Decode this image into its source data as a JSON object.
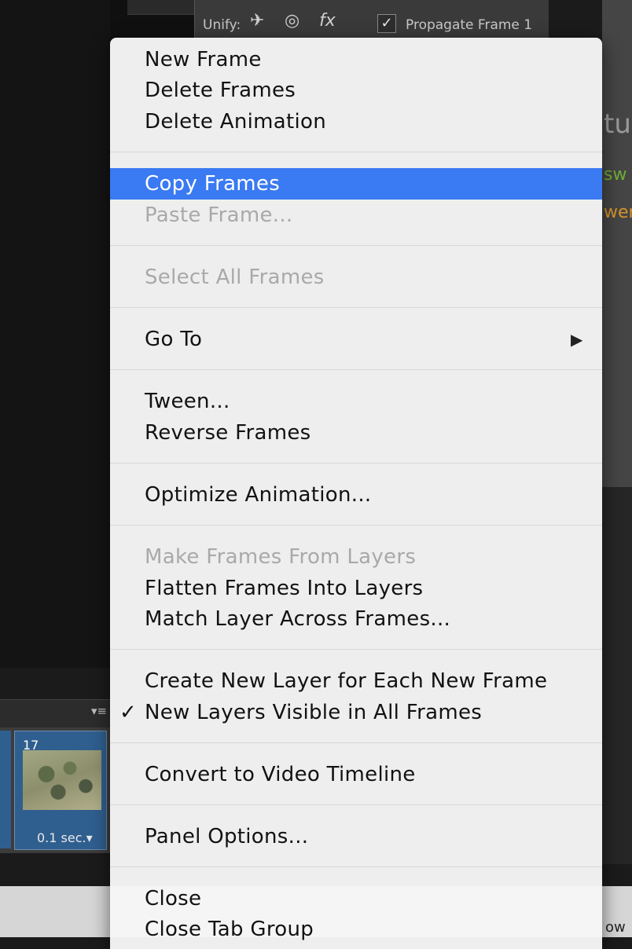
{
  "toolbar": {
    "unify_label": "Unify:",
    "icons": [
      "position-link-icon",
      "visibility-link-icon",
      "style-link-icon"
    ],
    "propagate_label": "Propagate Frame 1",
    "propagate_checked": true
  },
  "background": {
    "right_text_1": "tus",
    "right_text_2": "sw",
    "right_text_3": "wer",
    "bottom_right_text": "ow"
  },
  "frames": {
    "frame_number": "17",
    "frame_delay": "0.1 sec."
  },
  "menu": {
    "items": [
      {
        "label": "New Frame",
        "enabled": true
      },
      {
        "label": "Delete Frames",
        "enabled": true
      },
      {
        "label": "Delete Animation",
        "enabled": true
      },
      {
        "label": "Copy Frames",
        "enabled": true,
        "highlighted": true
      },
      {
        "label": "Paste Frame...",
        "enabled": false
      },
      {
        "label": "Select All Frames",
        "enabled": false
      },
      {
        "label": "Go To",
        "enabled": true,
        "submenu": true
      },
      {
        "label": "Tween...",
        "enabled": true
      },
      {
        "label": "Reverse Frames",
        "enabled": true
      },
      {
        "label": "Optimize Animation...",
        "enabled": true
      },
      {
        "label": "Make Frames From Layers",
        "enabled": false
      },
      {
        "label": "Flatten Frames Into Layers",
        "enabled": true
      },
      {
        "label": "Match Layer Across Frames...",
        "enabled": true
      },
      {
        "label": "Create New Layer for Each New Frame",
        "enabled": true
      },
      {
        "label": "New Layers Visible in All Frames",
        "enabled": true,
        "checked": true
      },
      {
        "label": "Convert to Video Timeline",
        "enabled": true
      },
      {
        "label": "Panel Options...",
        "enabled": true
      },
      {
        "label": "Close",
        "enabled": true
      },
      {
        "label": "Close Tab Group",
        "enabled": true
      }
    ],
    "highlight_color": "#3a7af2",
    "disabled_color": "#a9a9a9"
  }
}
